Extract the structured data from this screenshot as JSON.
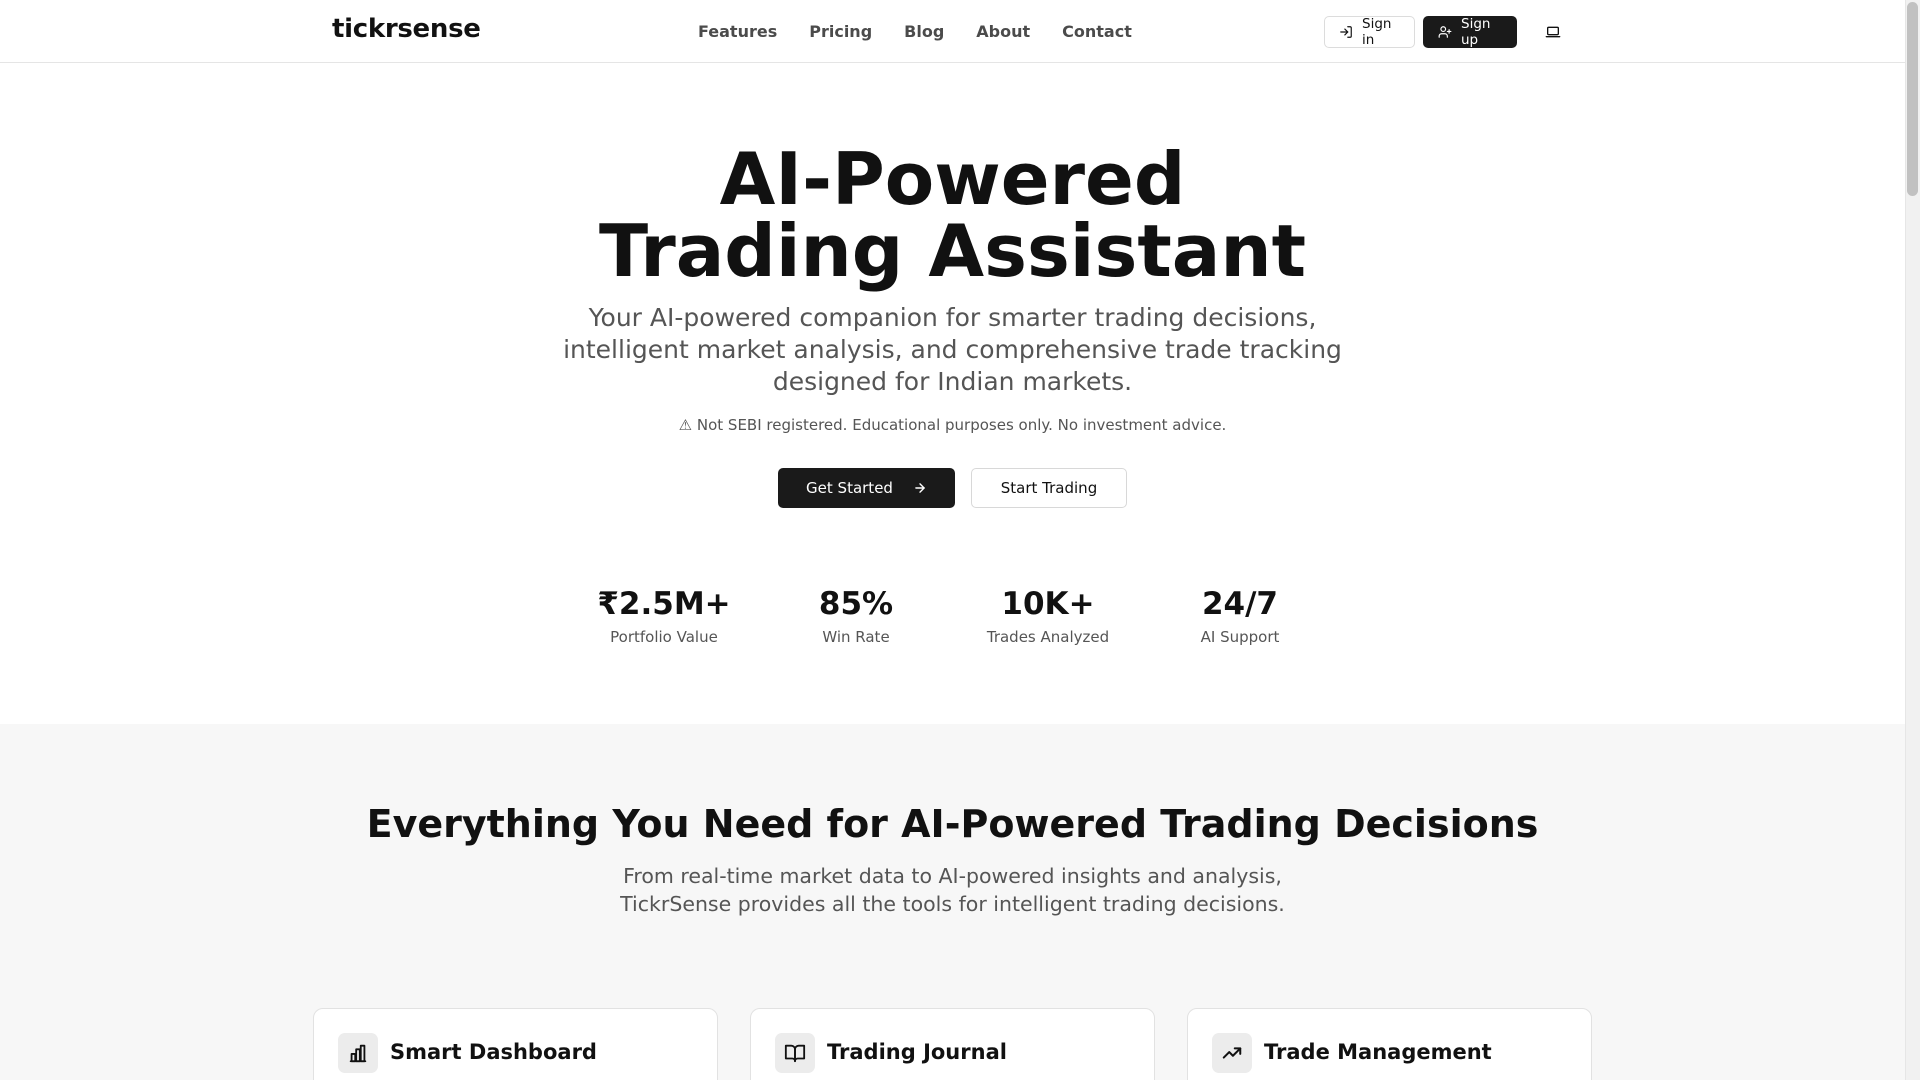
{
  "header": {
    "logo": "tickrsense",
    "nav": [
      "Features",
      "Pricing",
      "Blog",
      "About",
      "Contact"
    ],
    "sign_in": "Sign in",
    "sign_up": "Sign up"
  },
  "hero": {
    "title_line1": "AI-Powered",
    "title_line2": "Trading Assistant",
    "subtitle": "Your AI-powered companion for smarter trading decisions, intelligent market analysis, and comprehensive trade tracking designed for Indian markets.",
    "disclaimer": "⚠ Not SEBI registered. Educational purposes only. No investment advice.",
    "primary_cta": "Get Started",
    "secondary_cta": "Start Trading"
  },
  "stats": [
    {
      "value": "₹2.5M+",
      "label": "Portfolio Value"
    },
    {
      "value": "85%",
      "label": "Win Rate"
    },
    {
      "value": "10K+",
      "label": "Trades Analyzed"
    },
    {
      "value": "24/7",
      "label": "AI Support"
    }
  ],
  "features": {
    "title": "Everything You Need for AI-Powered Trading Decisions",
    "subtitle": "From real-time market data to AI-powered insights and analysis, TickrSense provides all the tools for intelligent trading decisions.",
    "cards": [
      {
        "title": "Smart Dashboard",
        "icon": "bar-chart-icon"
      },
      {
        "title": "Trading Journal",
        "icon": "book-open-icon"
      },
      {
        "title": "Trade Management",
        "icon": "trending-up-icon"
      }
    ]
  },
  "colors": {
    "primary": "#1a1a1a",
    "muted_text": "#555555",
    "section_bg": "#f7f7f7",
    "border": "#e5e5e5"
  }
}
